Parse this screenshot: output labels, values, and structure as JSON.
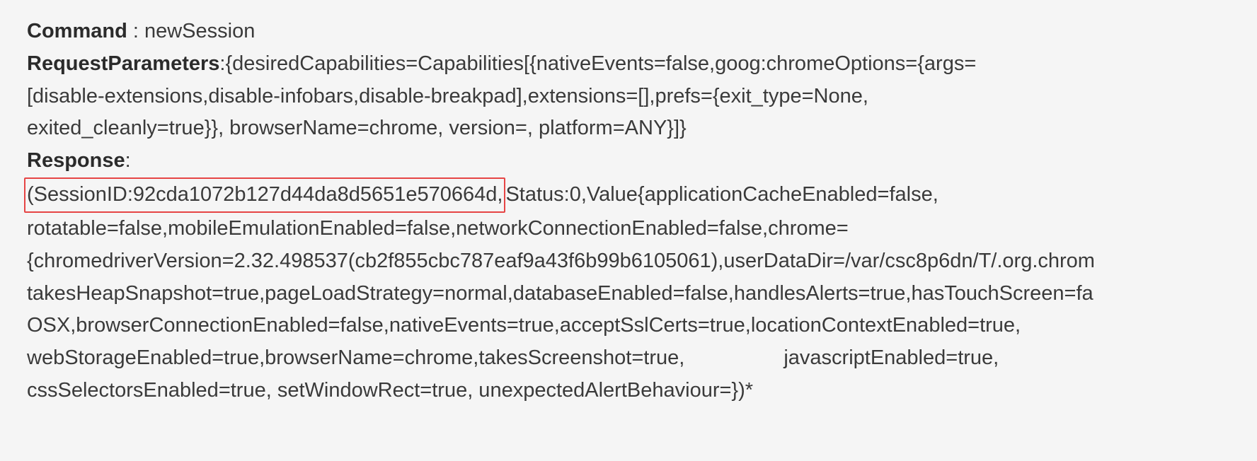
{
  "command": {
    "label": "Command",
    "sep": " : ",
    "value": "newSession"
  },
  "requestParameters": {
    "label": "RequestParameters",
    "sep": ":",
    "line1": "{desiredCapabilities=Capabilities[{nativeEvents=false,goog:chromeOptions={args=",
    "line2": "[disable-extensions,disable-infobars,disable-breakpad],extensions=[],prefs={exit_type=None,",
    "line3": "exited_cleanly=true}}, browserName=chrome, version=, platform=ANY}]}"
  },
  "response": {
    "label": "Response",
    "sep": ":",
    "highlighted": "(SessionID:92cda1072b127d44da8d5651e570664d,",
    "afterHighlight": "Status:0,Value{applicationCacheEnabled=false,",
    "line2": "rotatable=false,mobileEmulationEnabled=false,networkConnectionEnabled=false,chrome=",
    "line3": "{chromedriverVersion=2.32.498537(cb2f855cbc787eaf9a43f6b99b6105061),userDataDir=/var/csc8p6dn/T/.org.chrom",
    "line4": "takesHeapSnapshot=true,pageLoadStrategy=normal,databaseEnabled=false,handlesAlerts=true,hasTouchScreen=fa",
    "line5": "OSX,browserConnectionEnabled=false,nativeEvents=true,acceptSslCerts=true,locationContextEnabled=true,",
    "line6a": "webStorageEnabled=true,browserName=chrome,takesScreenshot=true,",
    "line6b": "javascriptEnabled=true,",
    "line7": "cssSelectorsEnabled=true, setWindowRect=true, unexpectedAlertBehaviour=})*"
  }
}
